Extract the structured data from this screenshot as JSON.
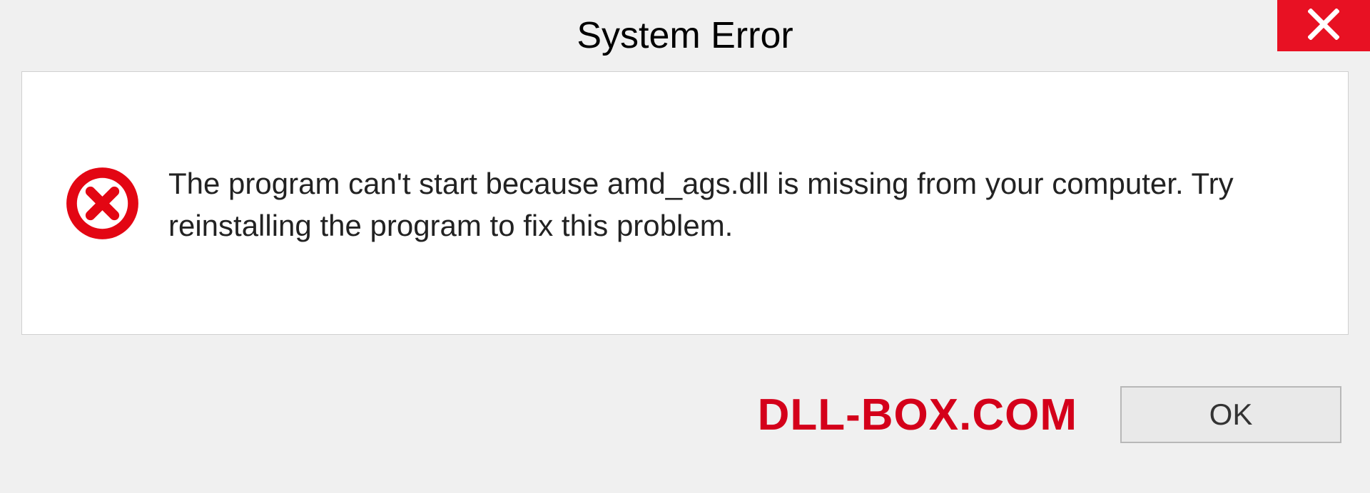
{
  "title": "System Error",
  "message": "The program can't start because amd_ags.dll is missing from your computer. Try reinstalling the program to fix this problem.",
  "ok_label": "OK",
  "watermark": "DLL-BOX.COM"
}
